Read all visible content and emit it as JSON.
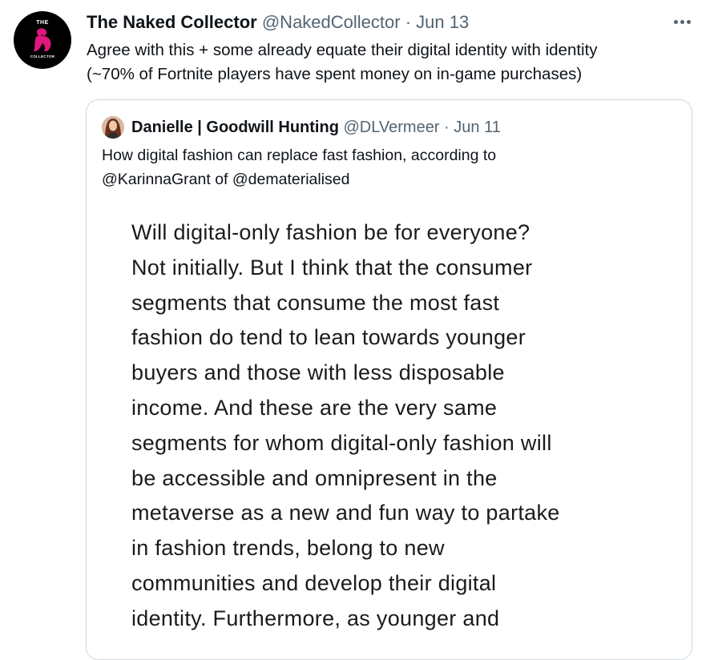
{
  "tweet": {
    "author_name": "The Naked Collector",
    "handle": "@NakedCollector",
    "separator": "·",
    "date": "Jun 13",
    "avatar": {
      "logo_top": "THE",
      "logo_bottom": "COLLECTOR",
      "accent_color": "#e0177f"
    },
    "text_lines": [
      "Agree with this + some already equate their digital identity with identity",
      "(~70% of Fortnite players have spent money on in-game purchases)"
    ],
    "more_icon": "more-horizontal-icon"
  },
  "quote": {
    "author_name": "Danielle | Goodwill Hunting",
    "handle": "@DLVermeer",
    "separator": "·",
    "date": "Jun 11",
    "text_lines": [
      "How digital fashion can replace fast fashion, according to",
      "@KarinnaGrant of @dematerialised"
    ],
    "image_text_lines": [
      "Will digital-only fashion be for everyone?",
      "Not initially. But I think that the consumer",
      "segments that consume the most fast",
      "fashion do tend to lean towards younger",
      "buyers and those with less disposable",
      "income. And these are the very same",
      "segments for whom digital-only fashion will",
      "be accessible and omnipresent in the",
      "metaverse as a new and fun way to partake",
      "in fashion trends, belong to new",
      "communities and develop their digital",
      "identity. Furthermore, as younger and"
    ]
  },
  "colors": {
    "text_primary": "#0f1419",
    "text_secondary": "#536471",
    "border": "#cfd9de"
  }
}
